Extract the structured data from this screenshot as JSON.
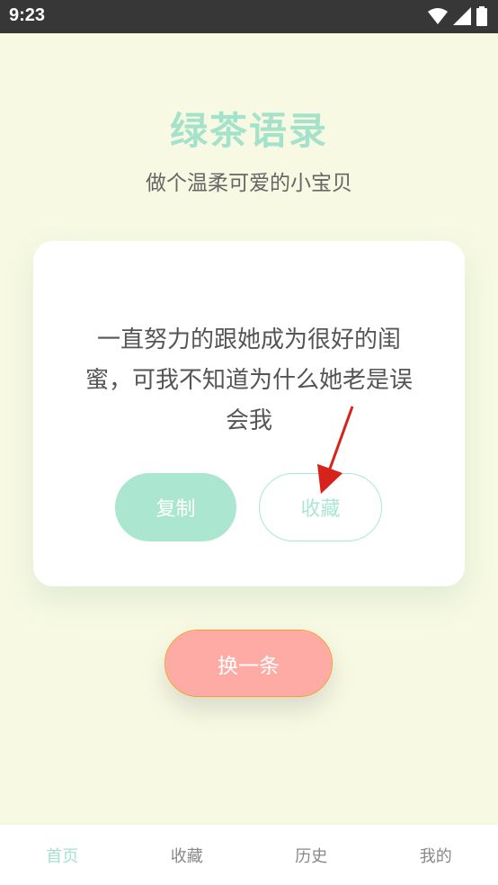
{
  "status_bar": {
    "time": "9:23",
    "icons": [
      "wifi-icon",
      "signal-icon",
      "battery-icon"
    ]
  },
  "app": {
    "title": "绿茶语录",
    "subtitle": "做个温柔可爱的小宝贝"
  },
  "quote_card": {
    "text": "一直努力的跟她成为很好的闺蜜，可我不知道为什么她老是误会我",
    "copy_label": "复制",
    "collect_label": "收藏"
  },
  "next_label": "换一条",
  "bottom_nav": {
    "items": [
      {
        "label": "首页",
        "active": true
      },
      {
        "label": "收藏",
        "active": false
      },
      {
        "label": "历史",
        "active": false
      },
      {
        "label": "我的",
        "active": false
      }
    ]
  },
  "colors": {
    "accent_green": "#a5e2cb",
    "accent_pink": "#ffaba5",
    "background": "#f7f9e2",
    "annotation_arrow": "#d8231c"
  }
}
